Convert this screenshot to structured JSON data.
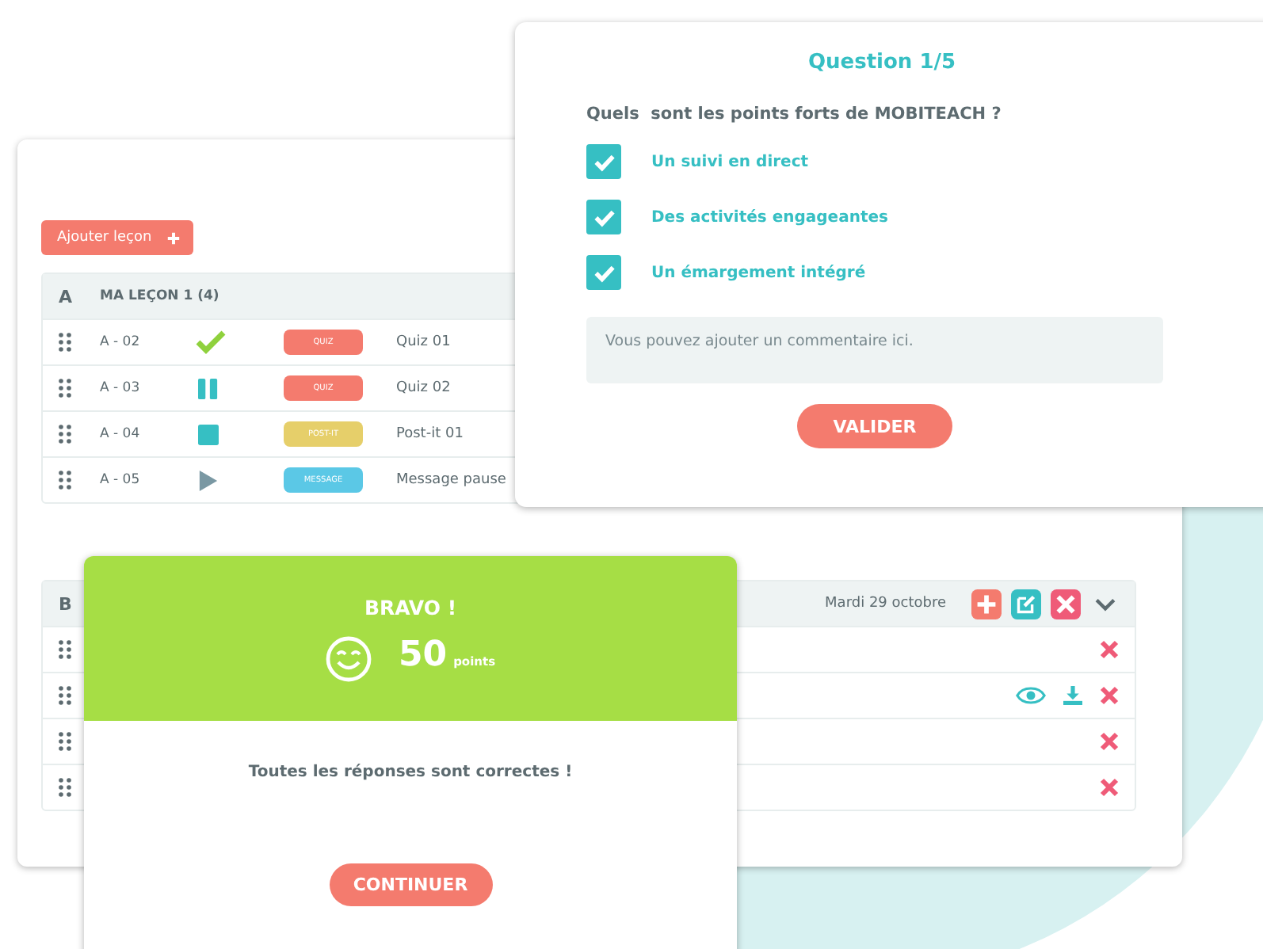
{
  "lessons_panel": {
    "add_button": "Ajouter leçon",
    "sections": [
      {
        "letter": "A",
        "title": "MA LEÇON 1 (4)",
        "rows": [
          {
            "code": "A - 02",
            "kind": "done",
            "tag": {
              "label": "QUIZ",
              "color": "#f47b6e"
            },
            "title": "Quiz 01"
          },
          {
            "code": "A - 03",
            "kind": "paused",
            "tag": {
              "label": "QUIZ",
              "color": "#f47b6e"
            },
            "title": "Quiz 02"
          },
          {
            "code": "A - 04",
            "kind": "stopped",
            "tag": {
              "label": "POST-IT",
              "color": "#e6cf6a"
            },
            "title": "Post-it 01"
          },
          {
            "code": "A - 05",
            "kind": "play",
            "tag": {
              "label": "MESSAGE",
              "color": "#5bc8e6"
            },
            "title": "Message pause"
          }
        ]
      },
      {
        "letter": "B",
        "date": "Mardi 29 octobre",
        "header_actions": [
          {
            "kind": "add"
          },
          {
            "kind": "edit"
          },
          {
            "kind": "delete"
          },
          {
            "kind": "expand"
          }
        ],
        "rows": [
          {
            "actions": [
              {
                "kind": "delete"
              }
            ]
          },
          {
            "actions": [
              {
                "kind": "view"
              },
              {
                "kind": "download"
              },
              {
                "kind": "delete"
              }
            ]
          },
          {
            "actions": [
              {
                "kind": "delete"
              }
            ]
          },
          {
            "actions": [
              {
                "kind": "delete"
              }
            ]
          }
        ]
      }
    ]
  },
  "question_card": {
    "title": "Question 1/5",
    "question": "Quels  sont les points forts de MOBITEACH ?",
    "options": [
      {
        "label": "Un suivi en direct",
        "checked": true
      },
      {
        "label": "Des activités engageantes",
        "checked": true
      },
      {
        "label": "Un émargement intégré",
        "checked": true
      }
    ],
    "comment": {
      "placeholder": "Vous pouvez ajouter un commentaire ici."
    },
    "submit_button": "VALIDER"
  },
  "result_card": {
    "title": "BRAVO !",
    "score": "50",
    "score_unit": "points",
    "message": "Toutes les réponses sont correctes !",
    "continue_button": "CONTINUER"
  }
}
